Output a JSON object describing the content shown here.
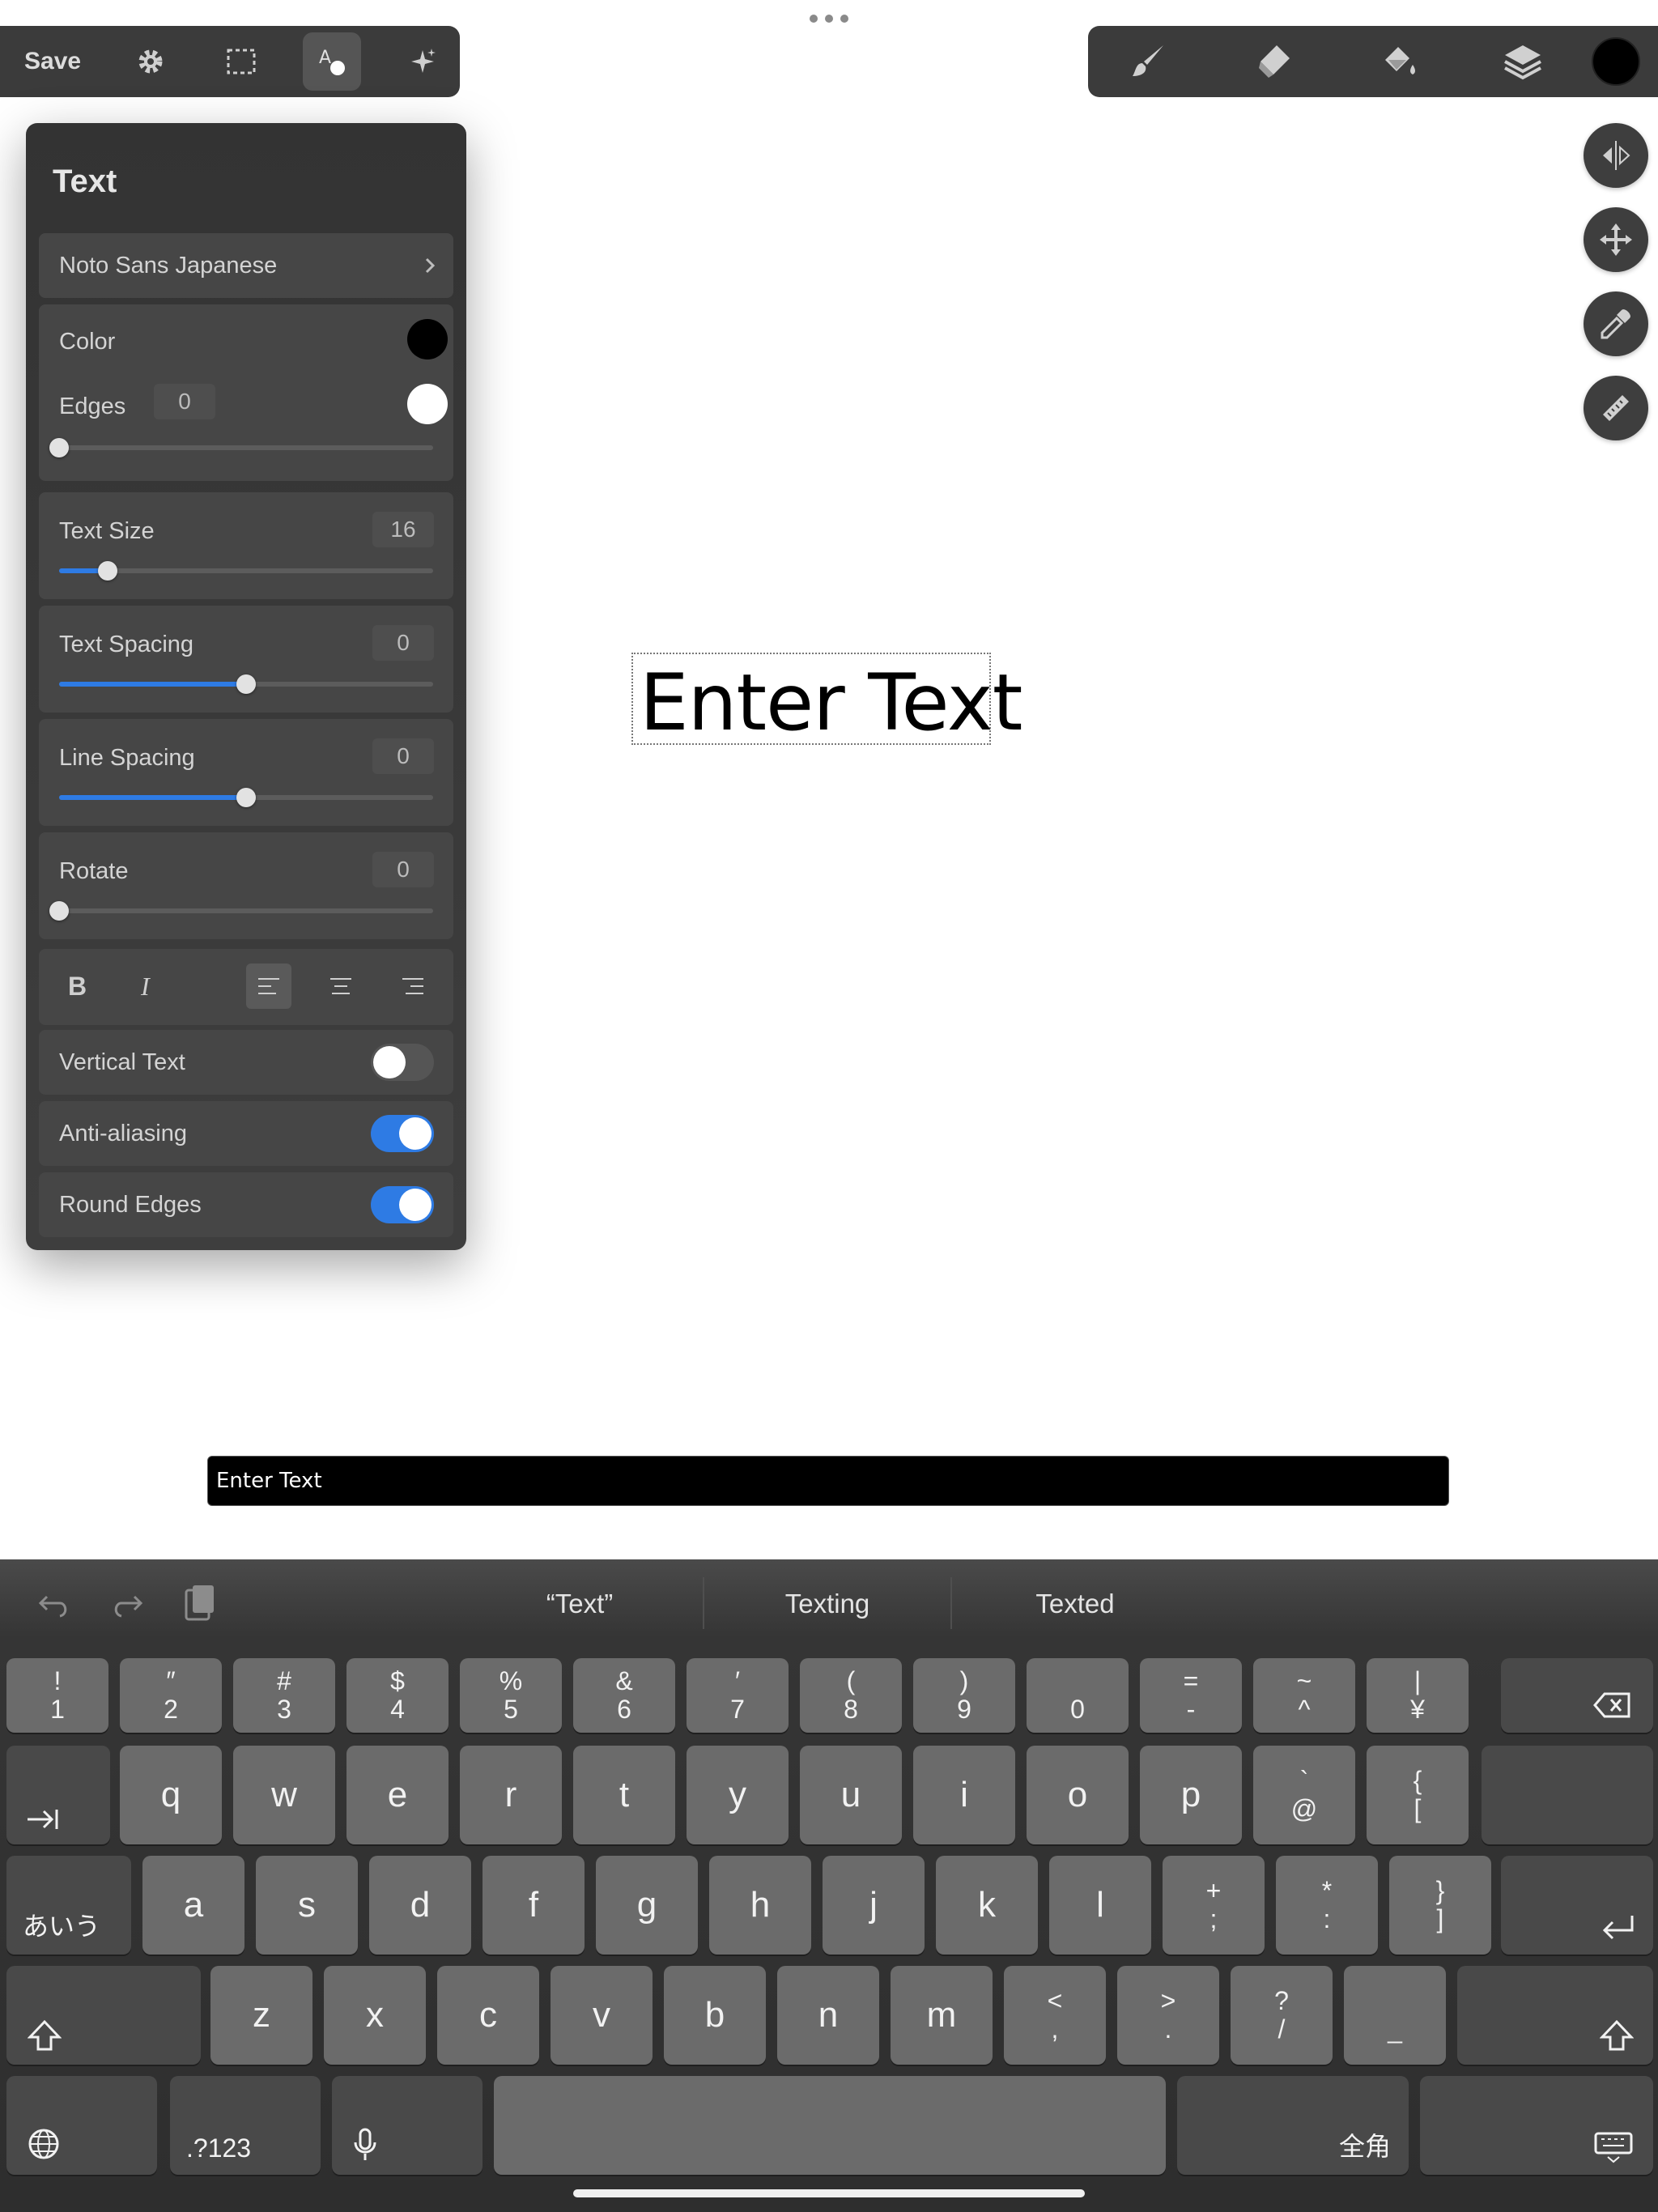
{
  "toolbar": {
    "save_label": "Save",
    "icons": [
      "gear-icon",
      "selection-icon",
      "text-tool-icon",
      "sparkle-icon"
    ],
    "active_tool": "text-tool-icon"
  },
  "right_toolbar": {
    "icons": [
      "brush-icon",
      "eraser-icon",
      "fill-bucket-icon",
      "layers-icon"
    ],
    "current_color": "#000000"
  },
  "side_buttons": [
    "flip-icon",
    "move-icon",
    "eyedropper-icon",
    "ruler-icon"
  ],
  "panel": {
    "title": "Text",
    "font_name": "Noto Sans Japanese",
    "color_label": "Color",
    "color_value": "#000000",
    "edges_label": "Edges",
    "edges_value": "0",
    "edges_color": "#ffffff",
    "edges_slider": 0,
    "text_size_label": "Text Size",
    "text_size_value": "16",
    "text_size_slider": 0.13,
    "text_spacing_label": "Text Spacing",
    "text_spacing_value": "0",
    "text_spacing_slider": 0.5,
    "line_spacing_label": "Line Spacing",
    "line_spacing_value": "0",
    "line_spacing_slider": 0.5,
    "rotate_label": "Rotate",
    "rotate_value": "0",
    "rotate_slider": 0,
    "bold_label": "B",
    "italic_label": "I",
    "alignment": "left",
    "vertical_text_label": "Vertical Text",
    "vertical_text_on": false,
    "anti_aliasing_label": "Anti-aliasing",
    "anti_aliasing_on": true,
    "round_edges_label": "Round Edges",
    "round_edges_on": true
  },
  "canvas": {
    "text": "Enter Text"
  },
  "input": {
    "value": "Enter Text"
  },
  "keyboard": {
    "suggestions": [
      "“Text”",
      "Texting",
      "Texted"
    ],
    "row1": [
      [
        "!",
        "1"
      ],
      [
        "″",
        "2"
      ],
      [
        "#",
        "3"
      ],
      [
        "$",
        "4"
      ],
      [
        "%",
        "5"
      ],
      [
        "&",
        "6"
      ],
      [
        "′",
        "7"
      ],
      [
        "(",
        "8"
      ],
      [
        ")",
        "9"
      ],
      [
        "",
        "0"
      ],
      [
        "=",
        "-"
      ],
      [
        "~",
        "^"
      ],
      [
        "|",
        "¥"
      ]
    ],
    "row2": [
      "q",
      "w",
      "e",
      "r",
      "t",
      "y",
      "u",
      "i",
      "o",
      "p"
    ],
    "row2_extra": [
      [
        "`",
        "@"
      ],
      [
        "{",
        "["
      ]
    ],
    "row3": [
      "a",
      "s",
      "d",
      "f",
      "g",
      "h",
      "j",
      "k",
      "l"
    ],
    "row3_extra": [
      [
        "+",
        ";"
      ],
      [
        "*",
        ":"
      ],
      [
        "}",
        "]"
      ]
    ],
    "row4": [
      "z",
      "x",
      "c",
      "v",
      "b",
      "n",
      "m"
    ],
    "row4_extra": [
      [
        "<",
        ","
      ],
      [
        ">",
        "."
      ],
      [
        "?",
        "/"
      ],
      [
        "",
        "_"
      ]
    ],
    "kana_label": "あいう",
    "numbers_label": ".?123",
    "zenkaku_label": "全角"
  }
}
